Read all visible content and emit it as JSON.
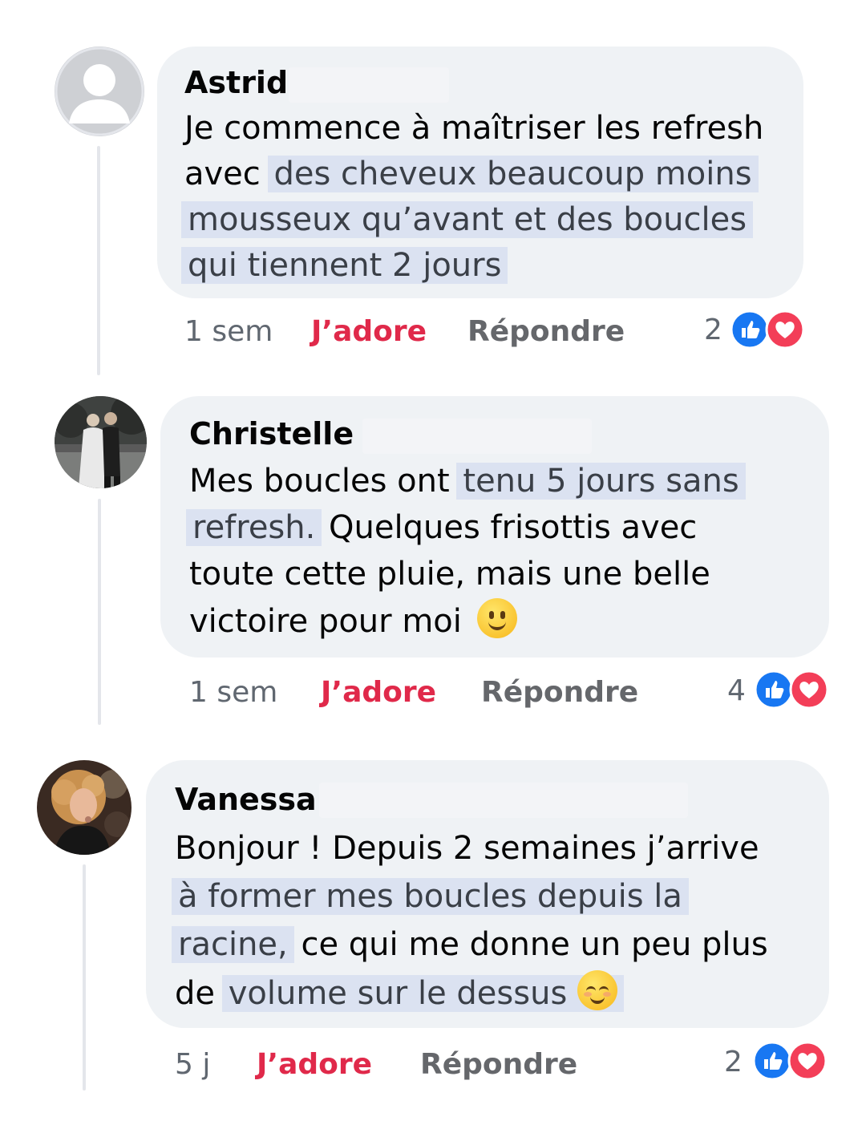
{
  "comments": [
    {
      "author": "Astrid",
      "lines": [
        {
          "plain": "Je commence à maîtriser les refresh",
          "hl": "",
          "after": ""
        },
        {
          "plain": "avec ",
          "hl": "des cheveux beaucoup moins",
          "after": ""
        },
        {
          "plain": "",
          "hl": "mousseux qu’avant et des boucles",
          "after": ""
        },
        {
          "plain": "",
          "hl": "qui tiennent 2 jours",
          "after": ""
        }
      ],
      "time": "1 sem",
      "love_label": "J’adore",
      "reply_label": "Répondre",
      "reaction_count": "2",
      "avatar": "default-profile-icon"
    },
    {
      "author": "Christelle J",
      "lines": [
        {
          "plain": "Mes boucles ont ",
          "hl": "tenu 5 jours sans",
          "after": ""
        },
        {
          "plain": "",
          "hl": "refresh.",
          "after": " Quelques frisottis avec"
        },
        {
          "plain": "toute cette pluie, mais une belle",
          "hl": "",
          "after": ""
        },
        {
          "plain": "victoire pour moi ",
          "hl": "",
          "after": ""
        }
      ],
      "emoji": "slightly-smiling-face",
      "time": "1 sem",
      "love_label": "J’adore",
      "reply_label": "Répondre",
      "reaction_count": "4",
      "avatar": "wedding-photo"
    },
    {
      "author": "Vanessa",
      "lines": [
        {
          "plain": "Bonjour ! Depuis 2 semaines j’arrive",
          "hl": "",
          "after": ""
        },
        {
          "plain": "",
          "hl": "à former mes boucles depuis la",
          "after": ""
        },
        {
          "plain": "",
          "hl": "racine,",
          "after": " ce qui me donne un peu plus"
        },
        {
          "plain": "de ",
          "hl": "volume sur le dessus ",
          "after": ""
        }
      ],
      "emoji": "relieved-face",
      "time": "5 j",
      "love_label": "J’adore",
      "reply_label": "Répondre",
      "reaction_count": "2",
      "avatar": "woman-curly-hair-photo"
    }
  ],
  "colors": {
    "bubble": "#eff2f5",
    "highlight": "#dbe2f1",
    "love": "#e0294a",
    "like_blue": "#1877f2",
    "heart_red": "#f33e58"
  }
}
